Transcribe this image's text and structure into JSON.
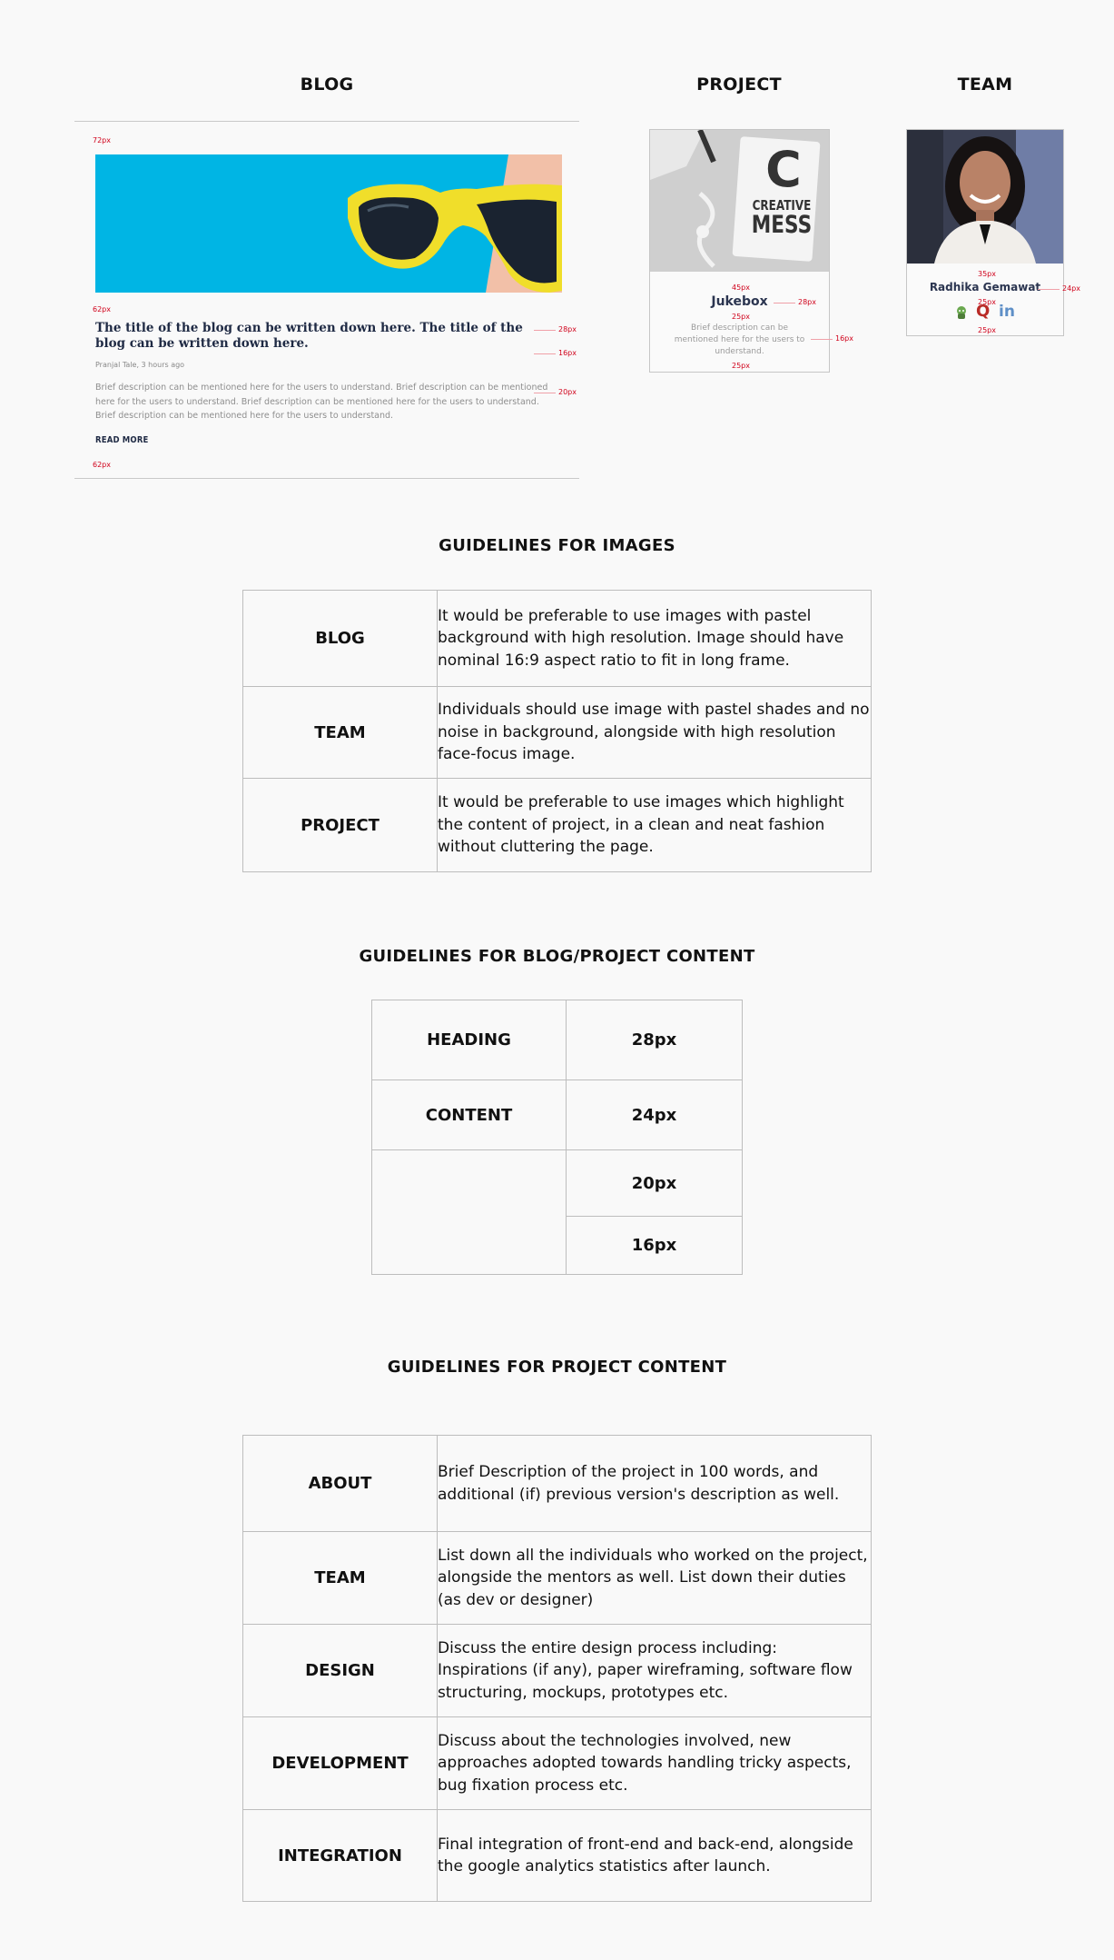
{
  "sections": {
    "blog": "BLOG",
    "project": "PROJECT",
    "team": "TEAM"
  },
  "blog_card": {
    "title": "The title of the blog can be written down here. The title of the blog can be written down here.",
    "meta": "Pranjal Tale, 3 hours ago",
    "description": "Brief description can be mentioned here for the users to understand. Brief description can be mentioned here for the users to understand. Brief description can be mentioned here for the users to understand. Brief description can be mentioned here for the users to understand.",
    "read_more": "READ MORE"
  },
  "project_card": {
    "image_text": [
      "C",
      "CREATIVE",
      "MESS"
    ],
    "title": "Jukebox",
    "description": "Brief description can be mentioned here for the users to understand."
  },
  "team_card": {
    "name": "Radhika Gemawat",
    "icons": [
      "github-icon",
      "quora-icon",
      "linkedin-icon"
    ]
  },
  "annotations": {
    "a72": "72px",
    "a62top": "62px",
    "a28blog": "28px",
    "a16blog": "16px",
    "a20blog": "20px",
    "a62bottom": "62px",
    "a45": "45px",
    "a28proj": "28px",
    "a25proj1": "25px",
    "a16proj": "16px",
    "a25proj2": "25px",
    "a35": "35px",
    "a24team": "24px",
    "a25team1": "25px",
    "a25team2": "25px"
  },
  "images_guidelines": {
    "title": "GUIDELINES FOR IMAGES",
    "rows": [
      {
        "key": "BLOG",
        "value": "It would be preferable to use images with pastel background with high resolution. Image should have nominal 16:9 aspect ratio to fit in long frame."
      },
      {
        "key": "TEAM",
        "value": "Individuals should use image with pastel shades and no noise in background, alongside with high resolution face-focus image."
      },
      {
        "key": "PROJECT",
        "value": "It would be preferable to use images which highlight the content of project, in a clean and neat fashion without cluttering the page."
      }
    ]
  },
  "content_guidelines": {
    "title": "GUIDELINES FOR BLOG/PROJECT CONTENT",
    "heading_label": "HEADING",
    "heading_size": "28px",
    "content_label": "CONTENT",
    "content_sizes": [
      "24px",
      "20px",
      "16px"
    ]
  },
  "project_guidelines": {
    "title": "GUIDELINES FOR PROJECT CONTENT",
    "rows": [
      {
        "key": "ABOUT",
        "value": "Brief Description of the project in 100 words, and additional (if) previous version's description as well."
      },
      {
        "key": "TEAM",
        "value": "List down all the individuals who worked on the project, alongside the mentors as well. List down their duties (as dev or designer)"
      },
      {
        "key": "DESIGN",
        "value": "Discuss the entire design process including: Inspirations (if any), paper wireframing, software flow structuring, mockups, prototypes etc."
      },
      {
        "key": "DEVELOPMENT",
        "value": "Discuss about the technologies involved, new approaches adopted towards handling tricky aspects, bug fixation process etc."
      },
      {
        "key": "INTEGRATION",
        "value": "Final integration of front-end and back-end, alongside the google analytics statistics after launch."
      }
    ]
  }
}
